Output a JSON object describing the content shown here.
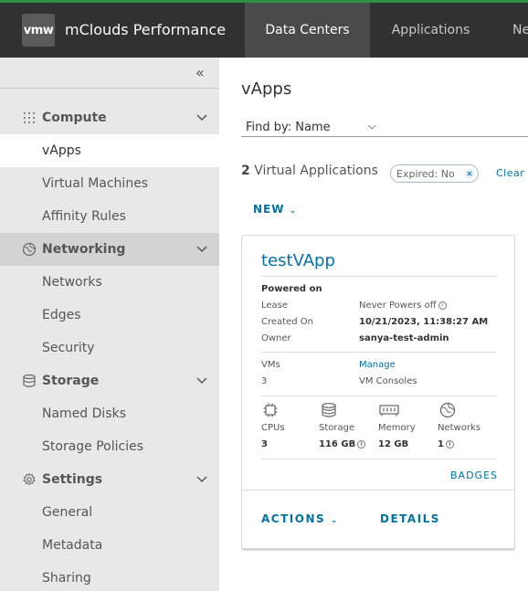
{
  "header": {
    "logo_text": "vmw",
    "app_title": "mClouds Performance",
    "nav": [
      {
        "label": "Data Centers",
        "active": true
      },
      {
        "label": "Applications",
        "active": false
      },
      {
        "label": "Ne",
        "active": false
      }
    ],
    "accent_color": "#2f8f45"
  },
  "sidebar": {
    "collapse_icon": "double-chevron-left",
    "sections": [
      {
        "label": "Compute",
        "icon": "grid-icon",
        "items": [
          "vApps",
          "Virtual Machines",
          "Affinity Rules"
        ]
      },
      {
        "label": "Networking",
        "icon": "globe-icon",
        "items": [
          "Networks",
          "Edges",
          "Security"
        ]
      },
      {
        "label": "Storage",
        "icon": "database-icon",
        "items": [
          "Named Disks",
          "Storage Policies"
        ]
      },
      {
        "label": "Settings",
        "icon": "gear-icon",
        "items": [
          "General",
          "Metadata",
          "Sharing"
        ]
      }
    ],
    "active_item": "vApps",
    "selected_section": "Networking"
  },
  "main": {
    "title": "vApps",
    "find_by": {
      "label": "Find by:",
      "value": "Name"
    },
    "count": "2",
    "count_label": "Virtual Applications",
    "filter_chip": {
      "key": "Expired:",
      "value": "No"
    },
    "clear_label": "Clear",
    "new_label": "NEW"
  },
  "card": {
    "title": "testVApp",
    "status": "Powered on",
    "lease_label": "Lease",
    "lease_value": "Never Powers off",
    "created_label": "Created On",
    "created_value": "10/21/2023, 11:38:27 AM",
    "owner_label": "Owner",
    "owner_value": "sanya-test-admin",
    "vms_label": "VMs",
    "vms_value": "3",
    "manage_label": "Manage",
    "vm_consoles_label": "VM Consoles",
    "resources": [
      {
        "label": "CPUs",
        "value": "3",
        "icon": "cpu-icon"
      },
      {
        "label": "Storage",
        "value": "116 GB",
        "icon": "database-icon"
      },
      {
        "label": "Memory",
        "value": "12 GB",
        "icon": "memory-icon"
      },
      {
        "label": "Networks",
        "value": "1",
        "icon": "globe-icon"
      }
    ],
    "badges_label": "BADGES",
    "actions_label": "ACTIONS",
    "details_label": "DETAILS"
  }
}
